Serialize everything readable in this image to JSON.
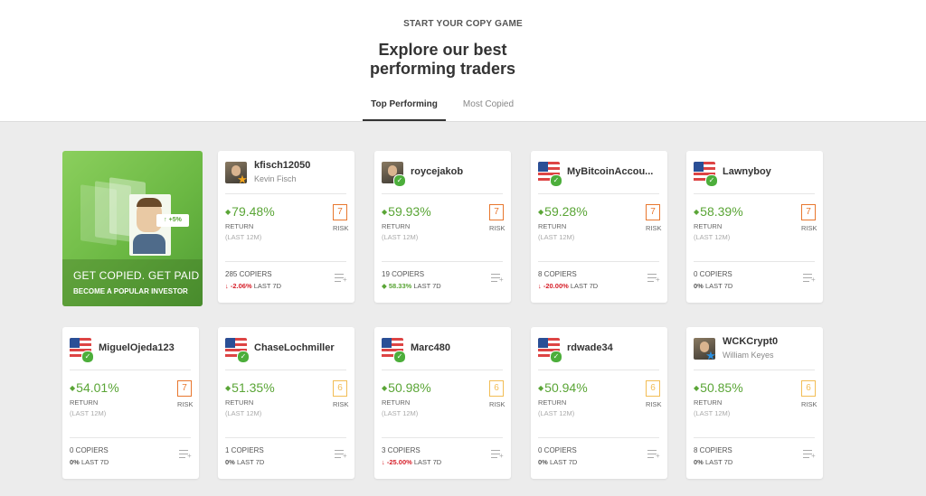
{
  "header": {
    "eyebrow": "START YOUR COPY GAME",
    "title_line1": "Explore our best",
    "title_line2": "performing traders",
    "tabs": [
      {
        "label": "Top Performing",
        "active": true
      },
      {
        "label": "Most Copied",
        "active": false
      }
    ]
  },
  "promo": {
    "line1": "GET COPIED. GET PAID",
    "line2": "BECOME A POPULAR INVESTOR",
    "tag": "+5%"
  },
  "labels": {
    "return": "RETURN",
    "return_period": "(LAST 12M)",
    "risk": "RISK",
    "last7": "LAST 7D"
  },
  "traders": [
    {
      "username": "kfisch12050",
      "full_name": "Kevin Fisch",
      "avatar": "photo",
      "badge": "star-gold",
      "return": "79.48%",
      "risk": "7",
      "copiers": "285 COPIERS",
      "change": "-2.06%",
      "change_dir": "neg"
    },
    {
      "username": "roycejakob",
      "full_name": "",
      "avatar": "photo",
      "badge": "check",
      "return": "59.93%",
      "risk": "7",
      "copiers": "19 COPIERS",
      "change": "58.33%",
      "change_dir": "pos"
    },
    {
      "username": "MyBitcoinAccou...",
      "full_name": "",
      "avatar": "flag",
      "badge": "check",
      "return": "59.28%",
      "risk": "7",
      "copiers": "8 COPIERS",
      "change": "-20.00%",
      "change_dir": "neg"
    },
    {
      "username": "Lawnyboy",
      "full_name": "",
      "avatar": "flag",
      "badge": "check",
      "return": "58.39%",
      "risk": "7",
      "copiers": "0 COPIERS",
      "change": "0%",
      "change_dir": "neu"
    },
    {
      "username": "MiguelOjeda123",
      "full_name": "",
      "avatar": "flag",
      "badge": "check",
      "return": "54.01%",
      "risk": "7",
      "copiers": "0 COPIERS",
      "change": "0%",
      "change_dir": "neu"
    },
    {
      "username": "ChaseLochmiller",
      "full_name": "",
      "avatar": "flag",
      "badge": "check",
      "return": "51.35%",
      "risk": "6",
      "copiers": "1 COPIERS",
      "change": "0%",
      "change_dir": "neu"
    },
    {
      "username": "Marc480",
      "full_name": "",
      "avatar": "flag",
      "badge": "check",
      "return": "50.98%",
      "risk": "6",
      "copiers": "3 COPIERS",
      "change": "-25.00%",
      "change_dir": "neg"
    },
    {
      "username": "rdwade34",
      "full_name": "",
      "avatar": "flag",
      "badge": "check",
      "return": "50.94%",
      "risk": "6",
      "copiers": "0 COPIERS",
      "change": "0%",
      "change_dir": "neu"
    },
    {
      "username": "WCKCrypt0",
      "full_name": "William Keyes",
      "avatar": "photo",
      "badge": "star-blue",
      "return": "50.85%",
      "risk": "6",
      "copiers": "8 COPIERS",
      "change": "0%",
      "change_dir": "neu"
    }
  ],
  "colors": {
    "accent_green": "#5aa536",
    "negative_red": "#d6202a",
    "risk_high": "#e8772e",
    "risk_mid": "#f2bd55"
  }
}
